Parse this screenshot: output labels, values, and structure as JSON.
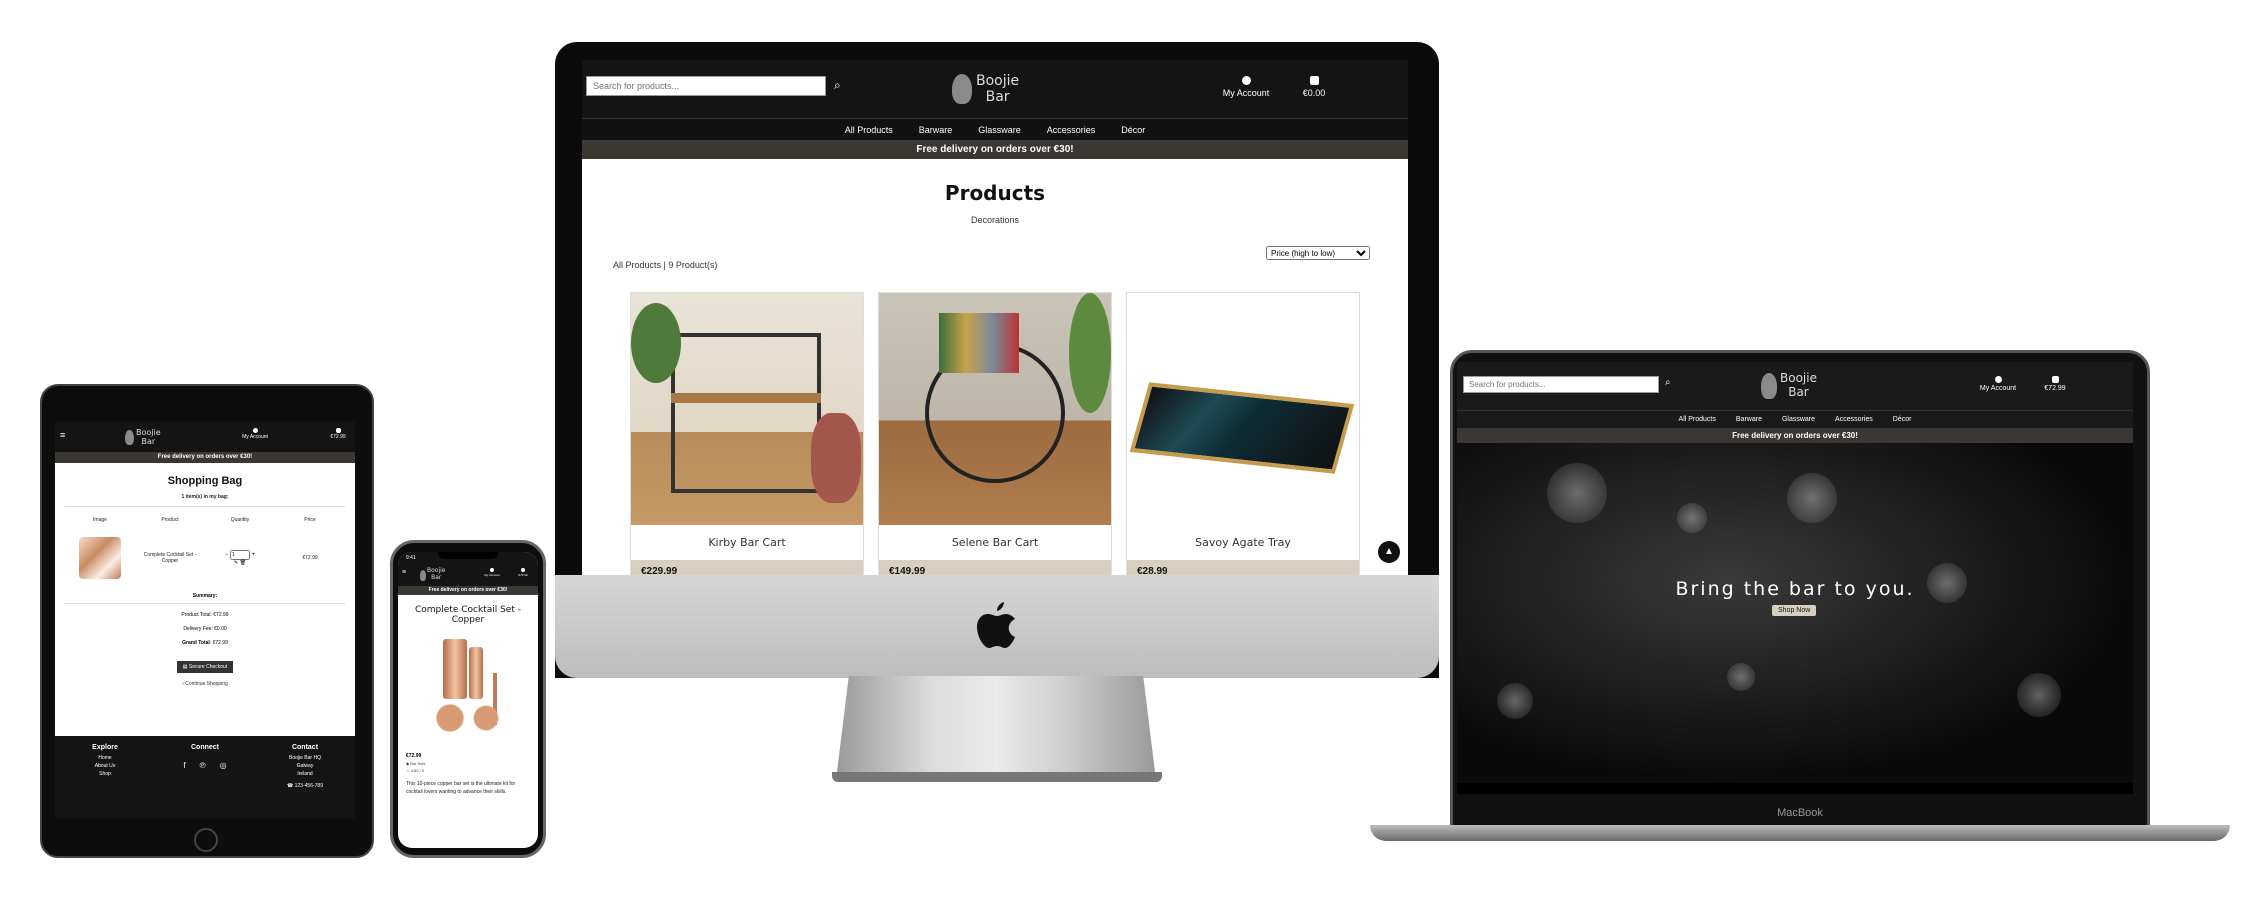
{
  "brand": {
    "line1": "Boojie",
    "line2": "Bar"
  },
  "search": {
    "placeholder": "Search for products..."
  },
  "account": {
    "label": "My Account"
  },
  "nav": [
    "All Products",
    "Barware",
    "Glassware",
    "Accessories",
    "Décor"
  ],
  "delivery_banner": "Free delivery on orders over €30!",
  "imac": {
    "cart_total": "€0.00",
    "page_title": "Products",
    "subtitle": "Decorations",
    "count_text": "All Products | 9 Product(s)",
    "sort_value": "Price (high to low)",
    "products": [
      {
        "name": "Kirby Bar Cart",
        "price": "€229.99"
      },
      {
        "name": "Selene Bar Cart",
        "price": "€149.99"
      },
      {
        "name": "Savoy Agate Tray",
        "price": "€28.99"
      }
    ]
  },
  "macbook": {
    "cart_total": "€72.99",
    "hero_text": "Bring the bar to you.",
    "hero_button": "Shop Now",
    "brand": "MacBook"
  },
  "ipad": {
    "cart_total": "€72.99",
    "title": "Shopping Bag",
    "items_count": "1 item(s) in my bag:",
    "columns": [
      "Image",
      "Product",
      "Quantity",
      "Price"
    ],
    "item": {
      "name": "Complete Cocktail Set - Copper",
      "qty": "1",
      "price": "€72.99"
    },
    "summary_label": "Summary:",
    "product_total": "Product Total: €72.99",
    "delivery_fee": "Delivery Fee: €0.00",
    "grand_total_label": "Grand Total",
    "grand_total_value": ": €72.99",
    "checkout": "Secure Checkout",
    "continue": "Continue Shopping",
    "footer": {
      "explore_title": "Explore",
      "explore_links": [
        "Home",
        "About Us",
        "Shop"
      ],
      "connect_title": "Connect",
      "contact_title": "Contact",
      "contact_lines": [
        "Boojie Bar HQ",
        "Galway",
        "Ireland"
      ],
      "phone": "123-456-789"
    }
  },
  "iphone": {
    "time": "9:41",
    "cart_total": "€72.99",
    "product_title": "Complete Cocktail Set - Copper",
    "price": "€72.99",
    "category": "Bar Sets",
    "rating": "4.80 / 5",
    "description": "This 10-piece copper bar set is the ultimate kit for cocktail lovers wanting to advance their skills."
  },
  "colors": {
    "accent_beige": "#d9cfc0",
    "banner": "#3b3834",
    "header": "#141414"
  }
}
